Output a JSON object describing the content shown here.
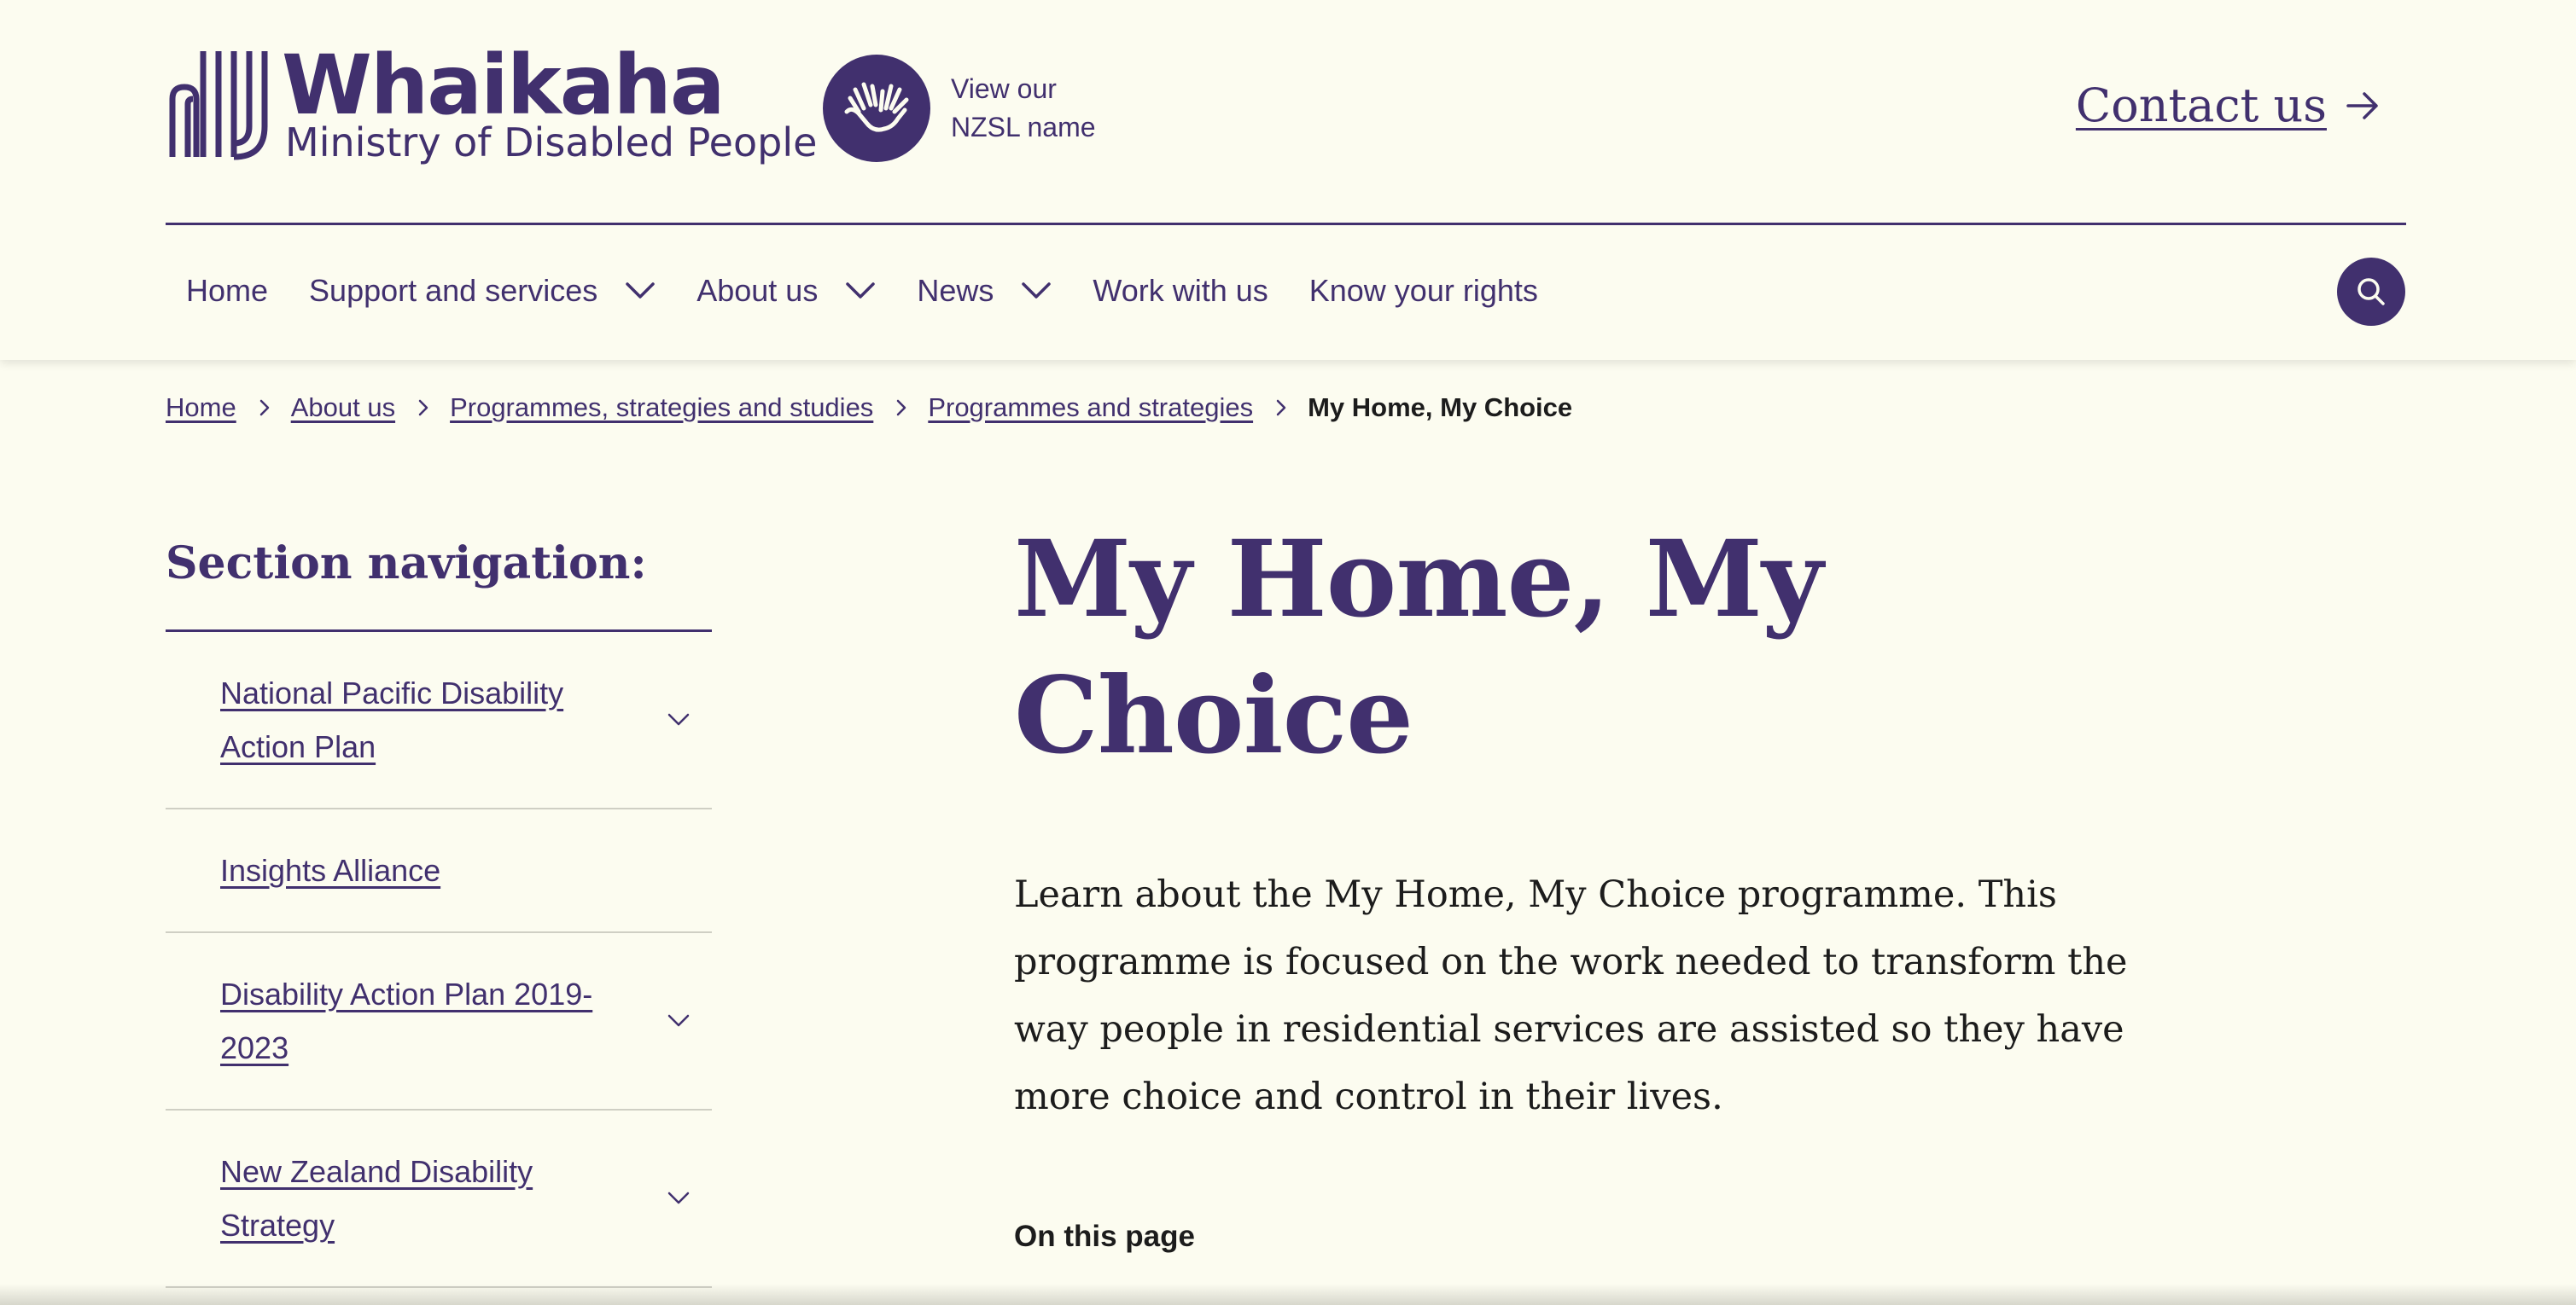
{
  "header": {
    "logo_name": "Whaikaha",
    "logo_subtitle": "Ministry of Disabled People",
    "nzsl_label": "View our NZSL name",
    "contact_label": "Contact us"
  },
  "nav": {
    "items": [
      {
        "label": "Home",
        "has_dropdown": false
      },
      {
        "label": "Support and services",
        "has_dropdown": true
      },
      {
        "label": "About us",
        "has_dropdown": true
      },
      {
        "label": "News",
        "has_dropdown": true
      },
      {
        "label": "Work with us",
        "has_dropdown": false
      },
      {
        "label": "Know your rights",
        "has_dropdown": false
      }
    ],
    "search_icon": "search-icon"
  },
  "breadcrumb": {
    "items": [
      "Home",
      "About us",
      "Programmes, strategies and studies",
      "Programmes and strategies"
    ],
    "current": "My Home, My Choice"
  },
  "sidenav": {
    "title": "Section navigation:",
    "items": [
      {
        "label": "National Pacific Disability Action Plan",
        "expandable": true
      },
      {
        "label": "Insights Alliance",
        "expandable": false
      },
      {
        "label": "Disability Action Plan 2019-2023",
        "expandable": true
      },
      {
        "label": "New Zealand Disability Strategy",
        "expandable": true
      }
    ]
  },
  "main": {
    "title": "My Home, My Choice",
    "intro": "Learn about the My Home, My Choice programme. This programme is focused on the work needed to transform the way people in residential services are assisted so they have more choice and control in their lives.",
    "on_this_page": "On this page"
  },
  "colors": {
    "brand": "#41306e",
    "background": "#fcfcf0",
    "text": "#1c1c1c"
  }
}
